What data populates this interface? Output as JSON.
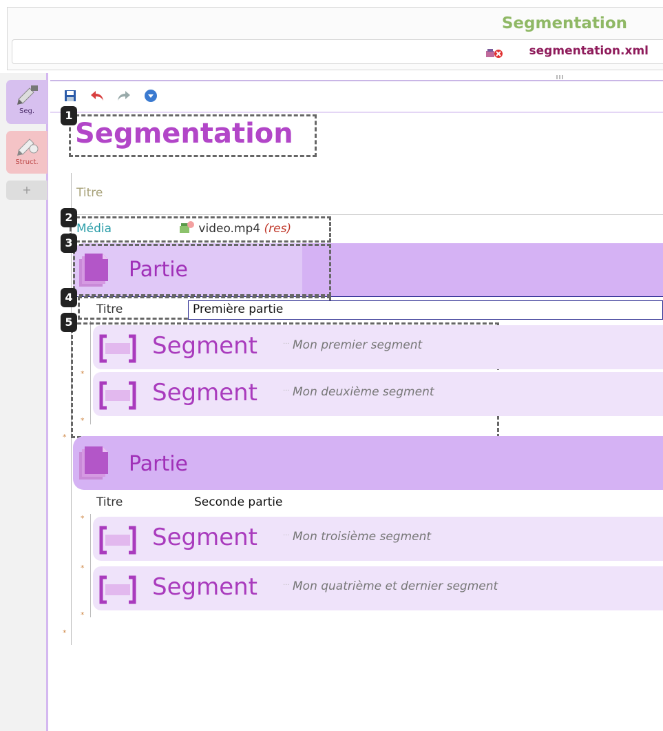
{
  "window": {
    "app_title": "Segmentation",
    "file_name": "segmentation.xml"
  },
  "tabs": [
    {
      "label": "Seg."
    },
    {
      "label": "Struct."
    },
    {
      "label": "+"
    }
  ],
  "document": {
    "title": "Segmentation",
    "titre_label": "Titre",
    "media": {
      "label": "Média",
      "file": "video.mp4",
      "note": "(res)"
    },
    "parts": [
      {
        "label": "Partie",
        "titre_label": "Titre",
        "titre_value": "Première partie",
        "segments": [
          {
            "label": "Segment",
            "description": "Mon premier segment"
          },
          {
            "label": "Segment",
            "description": "Mon deuxième segment"
          }
        ]
      },
      {
        "label": "Partie",
        "titre_label": "Titre",
        "titre_value": "Seconde partie",
        "segments": [
          {
            "label": "Segment",
            "description": "Mon troisième segment"
          },
          {
            "label": "Segment",
            "description": "Mon quatrième et dernier segment"
          }
        ]
      }
    ]
  },
  "callouts": [
    "1",
    "2",
    "3",
    "4",
    "5"
  ],
  "colors": {
    "accent_purple": "#b246c8",
    "partie_bg": "#d5b2f4",
    "segment_bg": "#efe3fa",
    "app_title_green": "#8fb865",
    "file_name_maroon": "#8e1a5a"
  }
}
